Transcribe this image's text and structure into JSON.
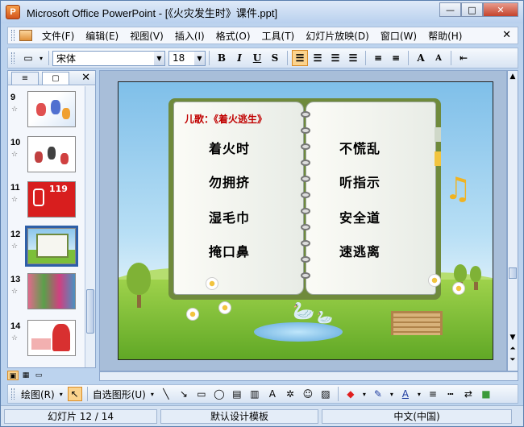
{
  "window": {
    "title": "Microsoft Office PowerPoint - [《火灾发生时》课件.ppt]",
    "app_icon": "P",
    "minimize": "—",
    "maximize": "□",
    "close": "✕"
  },
  "menubar": {
    "items": [
      "文件(F)",
      "编辑(E)",
      "视图(V)",
      "插入(I)",
      "格式(O)",
      "工具(T)",
      "幻灯片放映(D)",
      "窗口(W)",
      "帮助(H)"
    ],
    "close": "✕"
  },
  "toolbar": {
    "font_name": "宋体",
    "font_size": "18",
    "bold": "B",
    "italic": "I",
    "underline": "U",
    "shadow": "S",
    "grow_font": "A",
    "shrink_font": "A"
  },
  "pane": {
    "tab_outline": "≡",
    "tab_slides": "▢",
    "close": "✕",
    "thumbnails": [
      {
        "num": "9"
      },
      {
        "num": "10"
      },
      {
        "num": "11",
        "caption": "119"
      },
      {
        "num": "12"
      },
      {
        "num": "13"
      },
      {
        "num": "14"
      }
    ],
    "star": "☆"
  },
  "slide": {
    "song_title": "儿歌：《着火逃生》",
    "left_lines": [
      "着火时",
      "勿拥挤",
      "湿毛巾",
      "掩口鼻"
    ],
    "right_lines": [
      "不慌乱",
      "听指示",
      "安全道",
      "速逃离"
    ],
    "music_note": "♫"
  },
  "drawbar": {
    "draw_label": "绘图(R)",
    "autoshape_label": "自选图形(U)"
  },
  "status": {
    "slide_info": "幻灯片 12 / 14",
    "template": "默认设计模板",
    "language": "中文(中国)"
  },
  "colors": {
    "title_red": "#c00000",
    "accent_orange": "#fbd38d",
    "selection_blue": "#2d5fa8"
  }
}
